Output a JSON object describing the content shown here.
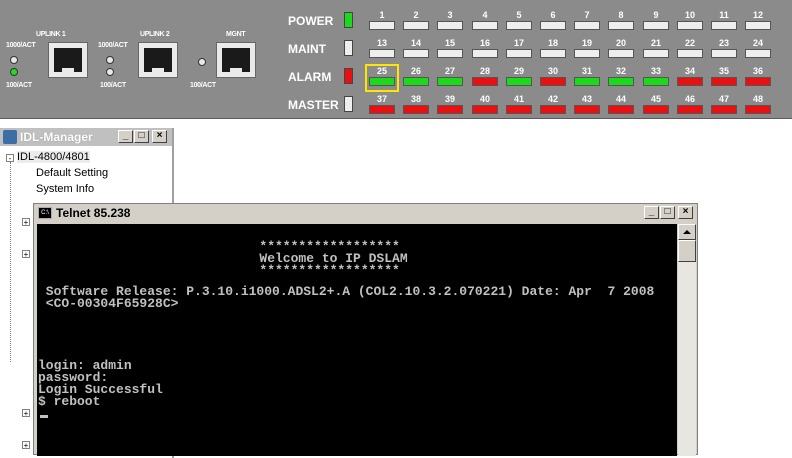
{
  "panel": {
    "uplink1_label": "UPLINK 1",
    "uplink2_label": "UPLINK 2",
    "mgmt_label": "MGNT",
    "act_1000": "1000/ACT",
    "act_100": "100/ACT",
    "rows": [
      {
        "label": "POWER",
        "led": "green"
      },
      {
        "label": "MAINT",
        "led": "off"
      },
      {
        "label": "ALARM",
        "led": "red"
      },
      {
        "label": "MASTER",
        "led": "off"
      }
    ],
    "ports": [
      {
        "num": "1",
        "state": "off"
      },
      {
        "num": "2",
        "state": "off"
      },
      {
        "num": "3",
        "state": "off"
      },
      {
        "num": "4",
        "state": "off"
      },
      {
        "num": "5",
        "state": "off"
      },
      {
        "num": "6",
        "state": "off"
      },
      {
        "num": "7",
        "state": "off"
      },
      {
        "num": "8",
        "state": "off"
      },
      {
        "num": "9",
        "state": "off"
      },
      {
        "num": "10",
        "state": "off"
      },
      {
        "num": "11",
        "state": "off"
      },
      {
        "num": "12",
        "state": "off"
      },
      {
        "num": "13",
        "state": "off"
      },
      {
        "num": "14",
        "state": "off"
      },
      {
        "num": "15",
        "state": "off"
      },
      {
        "num": "16",
        "state": "off"
      },
      {
        "num": "17",
        "state": "off"
      },
      {
        "num": "18",
        "state": "off"
      },
      {
        "num": "19",
        "state": "off"
      },
      {
        "num": "20",
        "state": "off"
      },
      {
        "num": "21",
        "state": "off"
      },
      {
        "num": "22",
        "state": "off"
      },
      {
        "num": "23",
        "state": "off"
      },
      {
        "num": "24",
        "state": "off"
      },
      {
        "num": "25",
        "state": "green",
        "selected": true
      },
      {
        "num": "26",
        "state": "green"
      },
      {
        "num": "27",
        "state": "green"
      },
      {
        "num": "28",
        "state": "red"
      },
      {
        "num": "29",
        "state": "green"
      },
      {
        "num": "30",
        "state": "red"
      },
      {
        "num": "31",
        "state": "green"
      },
      {
        "num": "32",
        "state": "green"
      },
      {
        "num": "33",
        "state": "green"
      },
      {
        "num": "34",
        "state": "red"
      },
      {
        "num": "35",
        "state": "red"
      },
      {
        "num": "36",
        "state": "red"
      },
      {
        "num": "37",
        "state": "red"
      },
      {
        "num": "38",
        "state": "red"
      },
      {
        "num": "39",
        "state": "red"
      },
      {
        "num": "40",
        "state": "red"
      },
      {
        "num": "41",
        "state": "red"
      },
      {
        "num": "42",
        "state": "red"
      },
      {
        "num": "43",
        "state": "red"
      },
      {
        "num": "44",
        "state": "red"
      },
      {
        "num": "45",
        "state": "red"
      },
      {
        "num": "46",
        "state": "red"
      },
      {
        "num": "47",
        "state": "red"
      },
      {
        "num": "48",
        "state": "red"
      }
    ]
  },
  "manager": {
    "title": "IDL-Manager",
    "tree_root": "IDL-4800/4801",
    "tree_items": [
      "Default Setting",
      "System Info"
    ]
  },
  "telnet": {
    "title": "Telnet 85.238",
    "lines": [
      "   ******************",
      "   Welcome to IP DSLAM",
      "   ******************",
      "",
      " Software Release: P.3.10.i1000.ADSL2+.A (COL2.10.3.2.070221) Date: Apr  7 2008",
      " <CO-00304F65928C>",
      "",
      "",
      "",
      "login: admin",
      "password:",
      "Login Successful",
      "$ reboot"
    ]
  },
  "colors": {
    "panel_bg": "#8b8b8b",
    "led_green": "#1cd91c",
    "led_red": "#e81010",
    "highlight": "#ffe600",
    "console_bg": "#000000",
    "console_fg": "#c0c0c0"
  }
}
